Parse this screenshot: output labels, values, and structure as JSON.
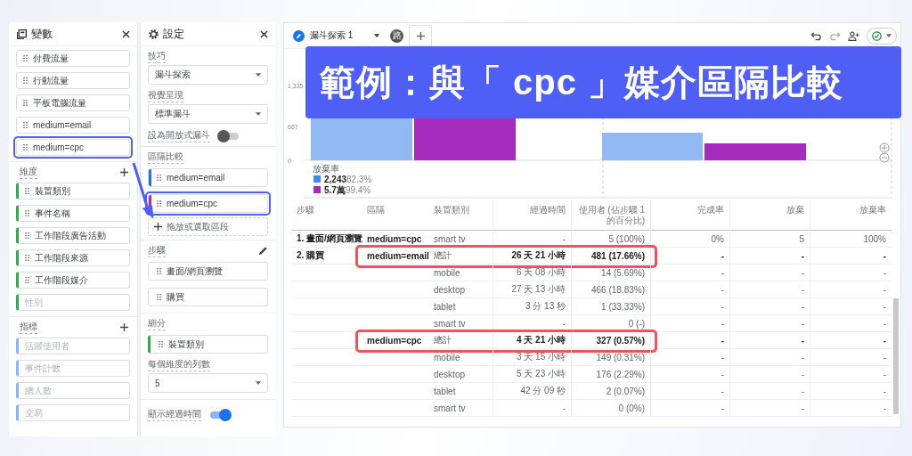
{
  "variables_panel": {
    "title": "變數",
    "segments": [
      {
        "label": "付費流量",
        "highlighted": false
      },
      {
        "label": "行動流量",
        "highlighted": false
      },
      {
        "label": "平板電腦流量",
        "highlighted": false
      },
      {
        "label": "medium=email",
        "highlighted": false
      },
      {
        "label": "medium=cpc",
        "highlighted": true
      }
    ],
    "dimensions": {
      "title": "維度",
      "items": [
        {
          "label": "裝置類別",
          "active": true
        },
        {
          "label": "事件名稱",
          "active": true
        },
        {
          "label": "工作階段廣告活動",
          "active": true
        },
        {
          "label": "工作階段來源",
          "active": true
        },
        {
          "label": "工作階段媒介",
          "active": true
        },
        {
          "label": "性別",
          "active": false
        }
      ]
    },
    "metrics": {
      "title": "指標",
      "items": [
        {
          "label": "活躍使用者",
          "active": false
        },
        {
          "label": "事件計數",
          "active": false
        },
        {
          "label": "總人數",
          "active": false
        },
        {
          "label": "交易",
          "active": false
        }
      ]
    }
  },
  "settings_panel": {
    "title": "設定",
    "technique": {
      "label": "技巧",
      "value": "漏斗探索"
    },
    "visualization": {
      "label": "視覺呈現",
      "value": "標準漏斗"
    },
    "open_funnel": {
      "label": "設為開放式漏斗",
      "on": false
    },
    "segment_comparison": {
      "label": "區隔比較",
      "items": [
        {
          "label": "medium=email",
          "color": "#1a73e8",
          "highlighted": false
        },
        {
          "label": "medium=cpc",
          "color": "#a52bbd",
          "highlighted": true
        }
      ],
      "drop_hint": "拖放或選取區段"
    },
    "steps": {
      "label": "步驟",
      "items": [
        "畫面/網頁瀏覽",
        "購買"
      ]
    },
    "breakdown": {
      "label": "細分",
      "items": [
        "裝置類別"
      ]
    },
    "rows_per_dimension": {
      "label": "每個維度的列數",
      "value": "5"
    },
    "show_elapsed_time": {
      "label": "顯示經過時間",
      "on": true
    }
  },
  "toolbar": {
    "tab": "漏斗探索 1",
    "badge": "路"
  },
  "chart": {
    "y_labels": [
      "1,335",
      "667",
      "0"
    ],
    "legend_title": "放棄率",
    "legend": [
      {
        "value": "2,243",
        "percent": "82.3%",
        "color": "#4285f4"
      },
      {
        "value": "5.7萬",
        "percent": "99.4%",
        "color": "#a52bbd"
      }
    ]
  },
  "table": {
    "columns": [
      "步驟",
      "區隔",
      "裝置類別",
      "經過時間",
      "使用者 (佔步驟 1 的百分比)",
      "完成率",
      "放棄",
      "放棄率"
    ],
    "rows": [
      {
        "step": "1. 畫面/網頁瀏覽",
        "segment": "medium=cpc",
        "device": "smart tv",
        "time": "-",
        "users": "5 (100%)",
        "completion": "0%",
        "abandon": "5",
        "abandon_rate": "100%",
        "total": false,
        "highlighted": false
      },
      {
        "step": "2. 購買",
        "segment": "medium=email",
        "device": "總計",
        "time": "26 天 21 小時",
        "users": "481 (17.66%)",
        "completion": "-",
        "abandon": "-",
        "abandon_rate": "-",
        "total": true,
        "highlighted": true
      },
      {
        "device": "mobile",
        "time": "6 天 08 小時",
        "users": "14 (5.69%)",
        "completion": "-",
        "abandon": "-",
        "abandon_rate": "-",
        "total": false,
        "highlighted": false
      },
      {
        "device": "desktop",
        "time": "27 天 13 小時",
        "users": "466 (18.83%)",
        "completion": "-",
        "abandon": "-",
        "abandon_rate": "-",
        "total": false,
        "highlighted": false
      },
      {
        "device": "tablet",
        "time": "3 分 13 秒",
        "users": "1 (33.33%)",
        "completion": "-",
        "abandon": "-",
        "abandon_rate": "-",
        "total": false,
        "highlighted": false
      },
      {
        "device": "smart tv",
        "time": "-",
        "users": "0 (-)",
        "completion": "-",
        "abandon": "-",
        "abandon_rate": "-",
        "total": false,
        "highlighted": false
      },
      {
        "segment": "medium=cpc",
        "device": "總計",
        "time": "4 天 21 小時",
        "users": "327 (0.57%)",
        "completion": "-",
        "abandon": "-",
        "abandon_rate": "-",
        "total": true,
        "highlighted": true
      },
      {
        "device": "mobile",
        "time": "3 天 15 小時",
        "users": "149 (0.31%)",
        "completion": "-",
        "abandon": "-",
        "abandon_rate": "-",
        "total": false,
        "highlighted": false
      },
      {
        "device": "desktop",
        "time": "5 天 23 小時",
        "users": "176 (2.29%)",
        "completion": "-",
        "abandon": "-",
        "abandon_rate": "-",
        "total": false,
        "highlighted": false
      },
      {
        "device": "tablet",
        "time": "42 分 09 秒",
        "users": "2 (0.07%)",
        "completion": "-",
        "abandon": "-",
        "abandon_rate": "-",
        "total": false,
        "highlighted": false
      },
      {
        "device": "smart tv",
        "time": "-",
        "users": "0 (0%)",
        "completion": "-",
        "abandon": "-",
        "abandon_rate": "-",
        "total": false,
        "highlighted": false
      }
    ]
  },
  "banner": "範例：與「 cpc 」媒介區隔比較"
}
